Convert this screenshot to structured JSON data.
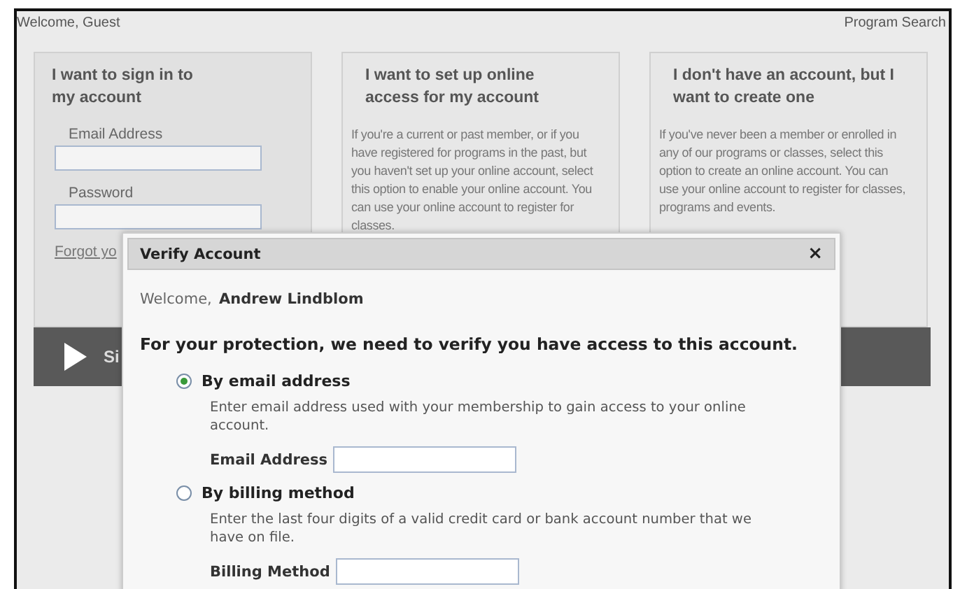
{
  "header": {
    "greeting": "Welcome, Guest",
    "link": "Program Search"
  },
  "panels": [
    {
      "kind": "signin",
      "title": "I want to sign in to my account",
      "fields": [
        "Email Address",
        "Password"
      ],
      "link": "Forgot yo"
    },
    {
      "kind": "info",
      "title": "I want to set up online access for my account",
      "text": "If you're a current or past member, or if you have registered for programs in the past, but you haven't set up your online account, select this option to enable your online account. You can use your online account to register for classes."
    },
    {
      "kind": "info",
      "title": "I don't have an account, but I want to create one",
      "text": "If you've never been a member or enrolled in any of our programs or classes, select this option to create an online account. You can use your online account to register for classes, programs and events."
    }
  ],
  "action_bar": {
    "label": "Si"
  },
  "dialog": {
    "title": "Verify Account",
    "close": "×",
    "welcome": "Welcome,",
    "name": "Andrew Lindblom",
    "heading": "For your protection, we need to verify you have access to this account.",
    "options": [
      {
        "label": "By email address",
        "selected": true,
        "description": "Enter email address used with your membership to gain access to your online account.",
        "field_label": "Email Address"
      },
      {
        "label": "By billing method",
        "selected": false,
        "description": "Enter the last four digits of a valid credit card or bank account number that we have on file.",
        "field_label": "Billing Method"
      }
    ]
  }
}
